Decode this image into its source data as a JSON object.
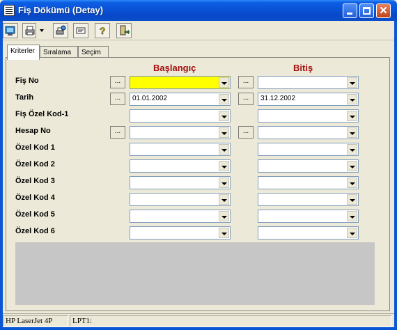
{
  "window": {
    "title": "Fiş Dökümü (Detay)"
  },
  "toolbar": {
    "buttons": [
      {
        "name": "preview-icon"
      },
      {
        "name": "printer-icon"
      },
      {
        "name": "print-setup-icon"
      },
      {
        "name": "export-icon"
      },
      {
        "name": "help-icon"
      },
      {
        "name": "exit-icon"
      }
    ]
  },
  "tabs": [
    {
      "label": "Kriterler",
      "active": true
    },
    {
      "label": "Sıralama",
      "active": false
    },
    {
      "label": "Seçim",
      "active": false
    }
  ],
  "columns": {
    "start": "Başlangıç",
    "end": "Bitiş"
  },
  "rows": [
    {
      "label": "Fiş No",
      "has_lookup": true,
      "start_value": "",
      "end_value": "",
      "start_highlight": "#ffff00"
    },
    {
      "label": "Tarih",
      "has_lookup": true,
      "start_value": "01.01.2002",
      "end_value": "31.12.2002"
    },
    {
      "label": "Fiş Özel Kod-1",
      "has_lookup": false,
      "start_value": "",
      "end_value": ""
    },
    {
      "label": "Hesap No",
      "has_lookup": true,
      "start_value": "",
      "end_value": ""
    },
    {
      "label": "Özel Kod 1",
      "has_lookup": false,
      "start_value": "",
      "end_value": ""
    },
    {
      "label": "Özel Kod 2",
      "has_lookup": false,
      "start_value": "",
      "end_value": ""
    },
    {
      "label": "Özel Kod 3",
      "has_lookup": false,
      "start_value": "",
      "end_value": ""
    },
    {
      "label": "Özel Kod 4",
      "has_lookup": false,
      "start_value": "",
      "end_value": ""
    },
    {
      "label": "Özel Kod 5",
      "has_lookup": false,
      "start_value": "",
      "end_value": ""
    },
    {
      "label": "Özel Kod 6",
      "has_lookup": false,
      "start_value": "",
      "end_value": ""
    }
  ],
  "lookup_label": "...",
  "status": {
    "printer": "HP LaserJet 4P",
    "port": "LPT1:"
  },
  "colors": {
    "accent_heading": "#a50f0f",
    "titlebar": "#0a55d8"
  }
}
